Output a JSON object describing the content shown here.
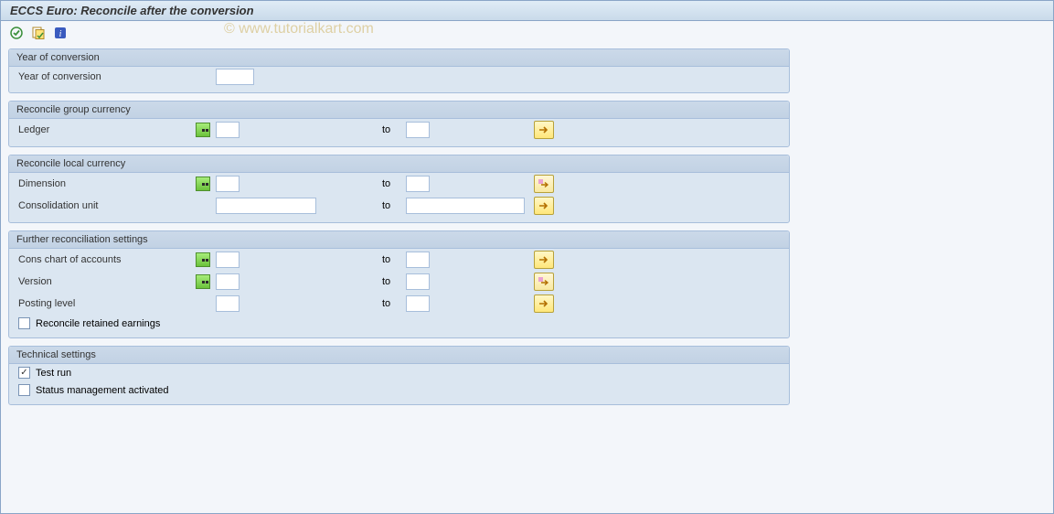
{
  "window": {
    "title": "ECCS Euro: Reconcile after the conversion"
  },
  "watermark": "© www.tutorialkart.com",
  "toolbar": {
    "execute_icon": "execute",
    "variant_icon": "variant",
    "info_icon": "info"
  },
  "groups": {
    "year": {
      "header": "Year of conversion",
      "fields": {
        "year_label": "Year of conversion"
      }
    },
    "group_cur": {
      "header": "Reconcile group currency",
      "fields": {
        "ledger_label": "Ledger",
        "to": "to"
      }
    },
    "local_cur": {
      "header": "Reconcile local currency",
      "fields": {
        "dimension_label": "Dimension",
        "cu_label": "Consolidation unit",
        "to": "to"
      }
    },
    "further": {
      "header": "Further reconciliation settings",
      "fields": {
        "coa_label": "Cons chart of accounts",
        "version_label": "Version",
        "plevel_label": "Posting level",
        "to": "to",
        "rre_label": "Reconcile retained earnings"
      }
    },
    "tech": {
      "header": "Technical settings",
      "fields": {
        "test_label": "Test run",
        "status_label": "Status management activated"
      }
    }
  },
  "values": {
    "year": "",
    "ledger_from": "",
    "ledger_to": "",
    "dim_from": "",
    "dim_to": "",
    "cu_from": "",
    "cu_to": "",
    "coa_from": "",
    "coa_to": "",
    "ver_from": "",
    "ver_to": "",
    "pl_from": "",
    "pl_to": "",
    "rre_checked": false,
    "test_checked": true,
    "status_checked": false
  }
}
